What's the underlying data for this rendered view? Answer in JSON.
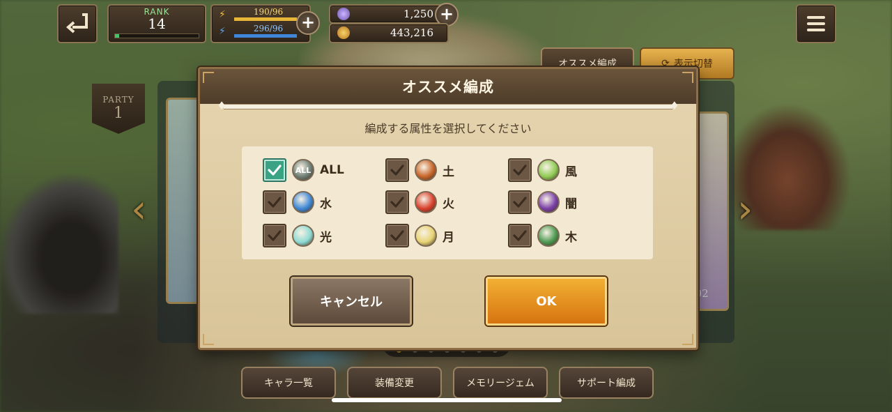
{
  "hud": {
    "rank_label": "RANK",
    "rank_value": "14",
    "rank_progress": 0.05,
    "stamina": "190/96",
    "stamina_fill": 1.0,
    "bp": "296/96",
    "bp_fill": 1.0,
    "gems": "1,250",
    "gold": "443,216"
  },
  "top_buttons": {
    "recommend": "オススメ編成",
    "toggle_view": "表示切替"
  },
  "party": {
    "label": "PARTY",
    "number": "1",
    "card_stat": "702"
  },
  "pager": {
    "total": 7,
    "current": 1
  },
  "bottom_tabs": [
    "キャラ一覧",
    "装備変更",
    "メモリージェム",
    "サポート編成"
  ],
  "modal": {
    "title": "オススメ編成",
    "prompt": "編成する属性を選択してください",
    "options": [
      {
        "label": "ALL",
        "icon": "ALL",
        "checked": true,
        "color": "#6f7f76"
      },
      {
        "label": "土",
        "icon": "earth-element-icon",
        "checked": false,
        "color": "#c9652a"
      },
      {
        "label": "風",
        "icon": "wind-element-icon",
        "checked": false,
        "color": "#8fcc54"
      },
      {
        "label": "水",
        "icon": "water-element-icon",
        "checked": false,
        "color": "#3f88d6"
      },
      {
        "label": "火",
        "icon": "fire-element-icon",
        "checked": false,
        "color": "#d8412d"
      },
      {
        "label": "闇",
        "icon": "dark-element-icon",
        "checked": false,
        "color": "#7a3fa8"
      },
      {
        "label": "光",
        "icon": "light-element-icon",
        "checked": false,
        "color": "#8edbd3"
      },
      {
        "label": "月",
        "icon": "moon-element-icon",
        "checked": false,
        "color": "#e8d474"
      },
      {
        "label": "木",
        "icon": "wood-element-icon",
        "checked": false,
        "color": "#4d9a52"
      }
    ],
    "cancel": "キャンセル",
    "ok": "OK"
  }
}
